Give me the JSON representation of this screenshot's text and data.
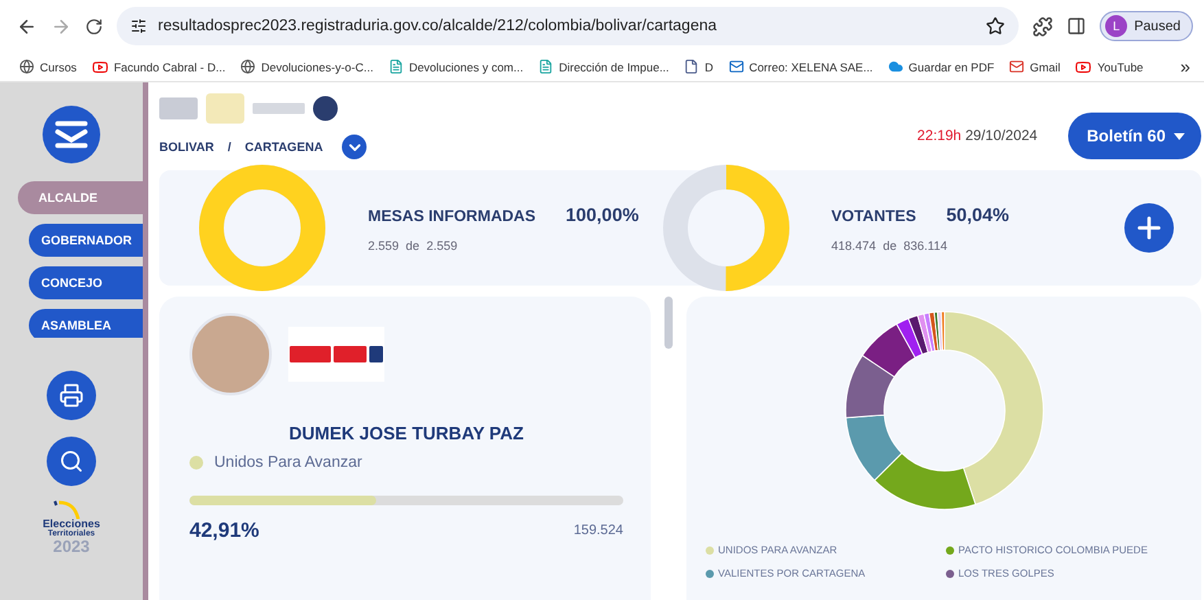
{
  "browser": {
    "url": "resultadosprec2023.registraduria.gov.co/alcalde/212/colombia/bolivar/cartagena",
    "profile": {
      "initial": "L",
      "label": "Paused"
    },
    "bookmarks": [
      {
        "label": "Cursos",
        "kind": "globe"
      },
      {
        "label": "Facundo Cabral - D...",
        "kind": "video"
      },
      {
        "label": "Devoluciones-y-o-C...",
        "kind": "globe"
      },
      {
        "label": "Devoluciones y com...",
        "kind": "doc"
      },
      {
        "label": "Dirección de Impue...",
        "kind": "doc"
      },
      {
        "label": "D",
        "kind": "file"
      },
      {
        "label": "Correo: XELENA SAE...",
        "kind": "mail"
      },
      {
        "label": "Guardar en PDF",
        "kind": "cloud"
      },
      {
        "label": "Gmail",
        "kind": "gmail"
      },
      {
        "label": "YouTube",
        "kind": "video"
      }
    ],
    "more": "»"
  },
  "sidebar": {
    "items": [
      {
        "label": "ALCALDE",
        "selected": true
      },
      {
        "label": "GOBERNADOR",
        "selected": false
      },
      {
        "label": "CONCEJO",
        "selected": false
      },
      {
        "label": "ASAMBLEA",
        "selected": false
      }
    ],
    "logo": {
      "line1": "Elecciones",
      "line2": "Territoriales",
      "year": "2023"
    }
  },
  "header": {
    "time": "22:19h",
    "date": "29/10/2024",
    "bulletin": "Boletín 60",
    "breadcrumb": [
      "BOLIVAR",
      "CARTAGENA"
    ],
    "separator": "/"
  },
  "stats": [
    {
      "title": "MESAS INFORMADAS",
      "percent": "100,00%",
      "count": "2.559",
      "of": "de",
      "total": "2.559",
      "level": 1
    },
    {
      "title": "VOTANTES",
      "percent": "50,04%",
      "count": "418.474",
      "of": "de",
      "total": "836.114",
      "level": 0.5004
    }
  ],
  "candidate": {
    "name": "DUMEK JOSE TURBAY PAZ",
    "party": "Unidos Para Avanzar",
    "color": "#dcdfa4",
    "level": 0.4291,
    "percent": "42,91%",
    "votes": "159.524"
  },
  "legend": [
    {
      "label": "UNIDOS PARA AVANZAR",
      "color": "#dcdfa4"
    },
    {
      "label": "PACTO HISTORICO COLOMBIA PUEDE",
      "color": "#74a81c"
    },
    {
      "label": "VALIENTES POR CARTAGENA",
      "color": "#5b9aad"
    },
    {
      "label": "LOS TRES GOLPES",
      "color": "#7b5f8f"
    }
  ]
}
